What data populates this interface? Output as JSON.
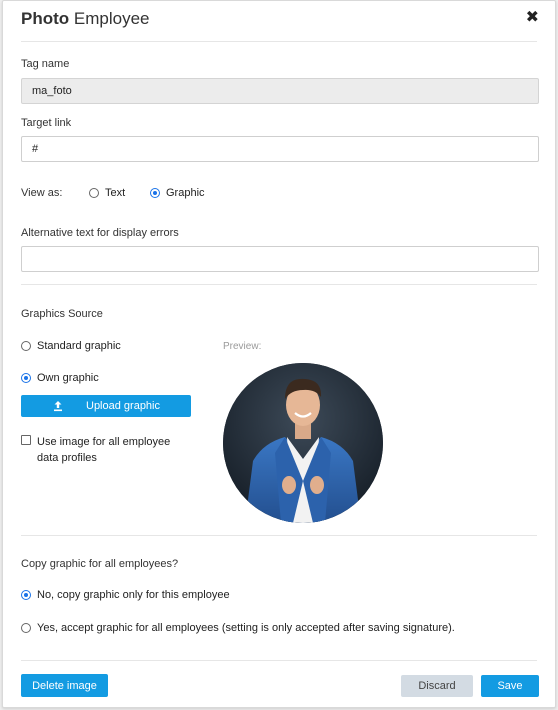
{
  "dialog": {
    "title_bold": "Photo",
    "title_rest": " Employee",
    "close_glyph": "✖"
  },
  "tag_name": {
    "label": "Tag name",
    "value": "ma_foto"
  },
  "target_link": {
    "label": "Target link",
    "value": "#"
  },
  "view_as": {
    "label": "View as:",
    "options": [
      {
        "label": "Text",
        "checked": false
      },
      {
        "label": "Graphic",
        "checked": true
      }
    ]
  },
  "alt_text": {
    "label": "Alternative text for display errors",
    "value": ""
  },
  "graphics_source": {
    "label": "Graphics Source",
    "options": [
      {
        "label": "Standard graphic",
        "checked": false
      },
      {
        "label": "Own graphic",
        "checked": true
      }
    ],
    "upload_label": "Upload graphic",
    "use_all_line1": "Use image for all employee",
    "use_all_line2": "data profiles",
    "use_all_checked": false,
    "preview_label": "Preview:"
  },
  "copy_graphic": {
    "question": "Copy graphic for all employees?",
    "options": [
      {
        "label": "No, copy graphic only for this employee",
        "checked": true
      },
      {
        "label": "Yes, accept graphic for all employees (setting is only accepted after saving signature).",
        "checked": false
      }
    ]
  },
  "footer": {
    "delete_label": "Delete image",
    "discard_label": "Discard",
    "save_label": "Save"
  },
  "colors": {
    "accent": "#139be2",
    "radio_checked": "#1a73e8",
    "discard_bg": "#d3dbe3"
  }
}
